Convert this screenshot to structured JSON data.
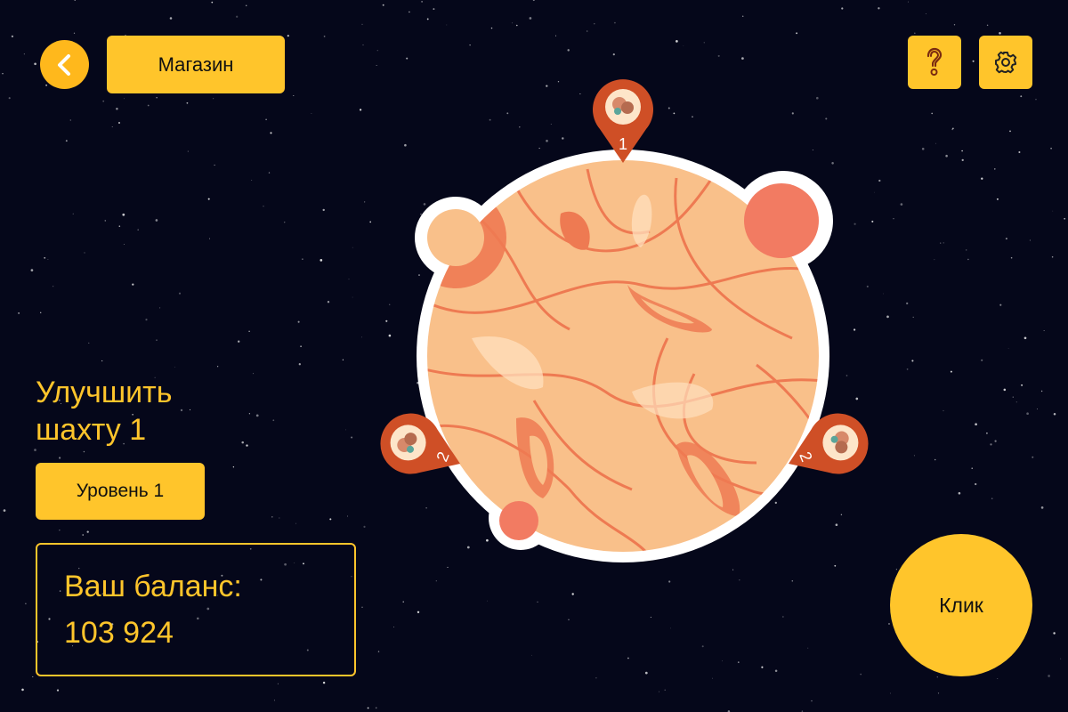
{
  "header": {
    "back_icon": "chevron-left-icon",
    "shop_label": "Магазин",
    "help_icon": "question-icon",
    "settings_icon": "gear-icon"
  },
  "upgrade": {
    "title_line1": "Улучшить",
    "title_line2": "шахту 1",
    "level_label": "Уровень 1"
  },
  "balance": {
    "label": "Ваш баланс:",
    "value": "103 924"
  },
  "click_button_label": "Клик",
  "planet": {
    "mines": [
      {
        "number": "1",
        "icon": "ore-icon"
      },
      {
        "number": "2",
        "icon": "ore-icon"
      },
      {
        "number": "2",
        "icon": "ore-icon"
      }
    ]
  },
  "colors": {
    "accent": "#ffc52b",
    "background": "#05071a",
    "planet": "#f9c08a",
    "planet_lines": "#ee7a52",
    "pin": "#cf4f26"
  }
}
